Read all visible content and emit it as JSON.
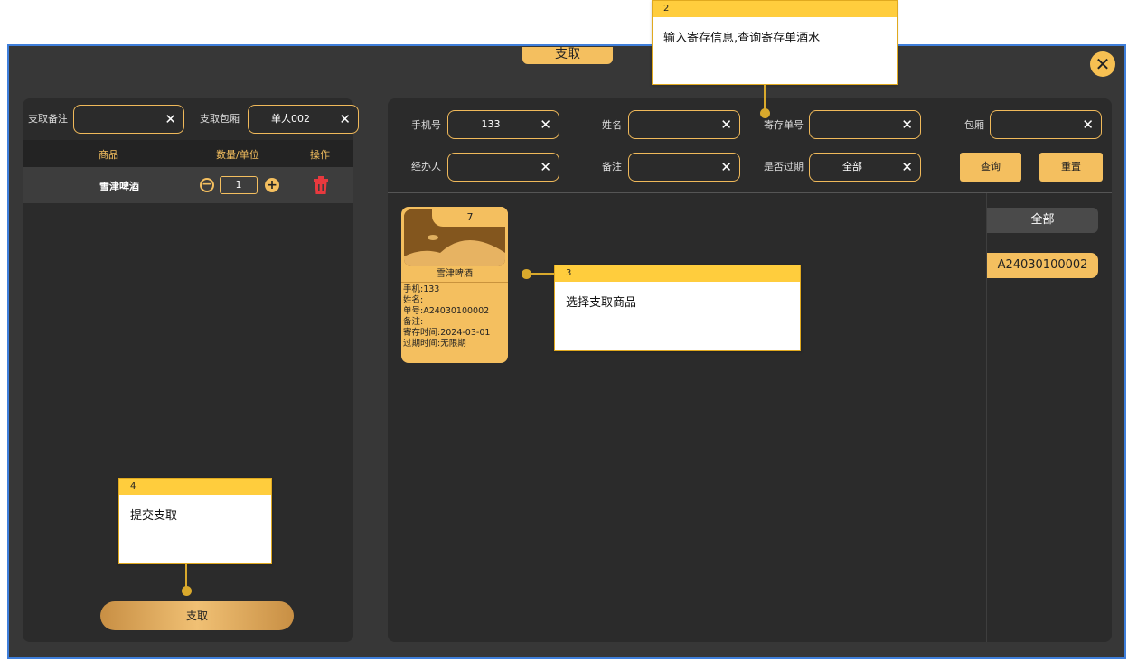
{
  "modal": {
    "title": "支取",
    "close_icon": "close-icon"
  },
  "left": {
    "remark_label": "支取备注",
    "remark_value": "",
    "room_label": "支取包厢",
    "room_value": "单人002",
    "table_headers": [
      "商品",
      "数量/单位",
      "操作"
    ],
    "row": {
      "name": "雪津啤酒",
      "qty": "1"
    },
    "submit_label": "支取"
  },
  "search": {
    "phone_label": "手机号",
    "phone_value": "133",
    "name_label": "姓名",
    "name_value": "",
    "order_label": "寄存单号",
    "order_value": "",
    "room_label": "包厢",
    "room_value": "",
    "agent_label": "经办人",
    "agent_value": "",
    "note_label": "备注",
    "note_value": "",
    "expired_label": "是否过期",
    "expired_value": "全部",
    "query_label": "查询",
    "reset_label": "重置"
  },
  "card": {
    "count": "7",
    "name": "雪津啤酒",
    "lines": [
      "手机:133",
      "姓名:",
      "单号:A24030100002",
      "备注:",
      "寄存时间:2024-03-01",
      "过期时间:无限期"
    ]
  },
  "categories": [
    "全部",
    "A24030100002"
  ],
  "tips": [
    {
      "num": "2",
      "text": "输入寄存信息,查询寄存单酒水"
    },
    {
      "num": "3",
      "text": "选择支取商品"
    },
    {
      "num": "4",
      "text": "提交支取"
    }
  ],
  "colors": {
    "accent": "#f4bf5f",
    "panel": "#2b2b2b",
    "background": "#373737",
    "danger": "#e8393e",
    "frame": "#3f7fdb"
  }
}
